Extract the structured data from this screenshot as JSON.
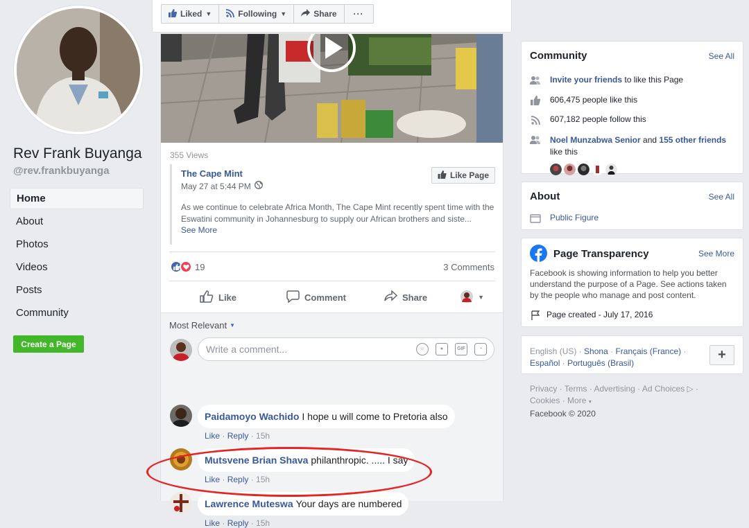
{
  "profile": {
    "name": "Rev Frank Buyanga",
    "handle": "@rev.frankbuyanga"
  },
  "nav": {
    "items": [
      "Home",
      "About",
      "Photos",
      "Videos",
      "Posts",
      "Community"
    ],
    "create_page": "Create a Page"
  },
  "actions": {
    "liked": "Liked",
    "following": "Following",
    "share": "Share"
  },
  "post": {
    "views": "355 Views",
    "shared_page": "The Cape Mint",
    "shared_time": "May 27 at 5:44 PM",
    "like_page": "Like Page",
    "text": "As we continue to celebrate Africa Month, The Cape Mint recently spent time with the Eswatini community in Johannesburg to supply our African brothers and siste...",
    "see_more": "See More",
    "reaction_count": "19",
    "comments_count": "3 Comments",
    "like": "Like",
    "comment": "Comment",
    "share": "Share"
  },
  "comments": {
    "sort": "Most Relevant",
    "placeholder": "Write a comment...",
    "like": "Like",
    "reply": "Reply",
    "items": [
      {
        "author": "Paidamoyo Wachido",
        "text": "I hope u will come to Pretoria also",
        "time": "15h"
      },
      {
        "author": "Mutsvene Brian Shava",
        "text": "philanthropic. ..... I say",
        "time": "15h"
      },
      {
        "author": "Lawrence Muteswa",
        "text": "Your days are numbered",
        "time": "15h"
      }
    ]
  },
  "community": {
    "title": "Community",
    "see_all": "See All",
    "invite_link": "Invite your friends",
    "invite_rest": "to like this Page",
    "likes": "606,475 people like this",
    "follows": "607,182 people follow this",
    "friend_name": "Noel Munzabwa Senior",
    "friend_and": "and",
    "friend_others": "155 other friends",
    "friend_rest": "like this"
  },
  "about": {
    "title": "About",
    "see_all": "See All",
    "category": "Public Figure"
  },
  "transparency": {
    "title": "Page Transparency",
    "see_more": "See More",
    "text": "Facebook is showing information to help you better understand the purpose of a Page. See actions taken by the people who manage and post content.",
    "created": "Page created - July 17, 2016"
  },
  "languages": {
    "current": "English (US)",
    "others": [
      "Shona",
      "Français (France)",
      "Español",
      "Português (Brasil)"
    ],
    "sep": "·"
  },
  "footer": {
    "links": [
      "Privacy",
      "Terms",
      "Advertising",
      "Ad Choices",
      "Cookies",
      "More"
    ],
    "copyright": "Facebook © 2020"
  },
  "colors": {
    "brand": "#4267b2",
    "link": "#385898",
    "create_green": "#42b72a",
    "highlight_red": "#e52424",
    "love_red": "#f33e58"
  }
}
